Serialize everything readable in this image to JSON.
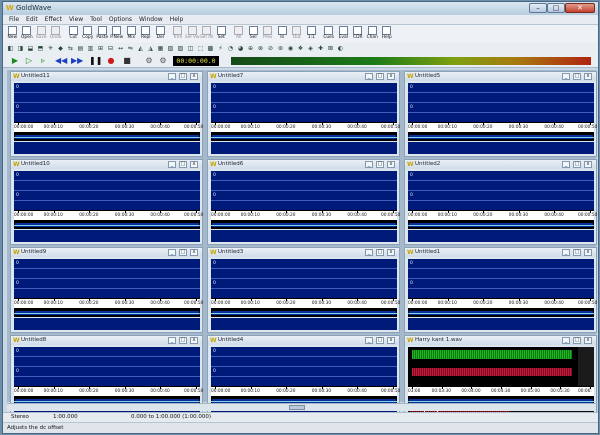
{
  "window": {
    "title": "GoldWave"
  },
  "menu": [
    "File",
    "Edit",
    "Effect",
    "View",
    "Tool",
    "Options",
    "Window",
    "Help"
  ],
  "toolbar": [
    {
      "label": "New",
      "enabled": true
    },
    {
      "label": "Open",
      "enabled": true
    },
    {
      "label": "Save",
      "enabled": false
    },
    {
      "label": "Undo",
      "enabled": false
    },
    {
      "label": "Cut",
      "enabled": true
    },
    {
      "label": "Copy",
      "enabled": true
    },
    {
      "label": "Paste",
      "enabled": true
    },
    {
      "label": "P.New",
      "enabled": true
    },
    {
      "label": "Mix",
      "enabled": true
    },
    {
      "label": "Repl",
      "enabled": true
    },
    {
      "label": "Del",
      "enabled": true
    },
    {
      "label": "Trim",
      "enabled": false
    },
    {
      "label": "Sel Vw",
      "enabled": false
    },
    {
      "label": "Sel All",
      "enabled": false
    },
    {
      "label": "Set",
      "enabled": true
    },
    {
      "label": "All",
      "enabled": false
    },
    {
      "label": "Sel",
      "enabled": true
    },
    {
      "label": "Prev",
      "enabled": false
    },
    {
      "label": "In",
      "enabled": true
    },
    {
      "label": "Out",
      "enabled": false
    },
    {
      "label": "1:1",
      "enabled": true
    },
    {
      "label": "Cues",
      "enabled": true
    },
    {
      "label": "Eval",
      "enabled": true
    },
    {
      "label": "CDR",
      "enabled": true
    },
    {
      "label": "Chan",
      "enabled": true
    },
    {
      "label": "Help",
      "enabled": true
    }
  ],
  "transport": {
    "counter": "00:00:00.0"
  },
  "documents": [
    {
      "name": "Untitled11",
      "ticks": [
        "00:00:00",
        "00:00:10",
        "00:00:20",
        "00:00:30",
        "00:00:40",
        "00:00:50"
      ],
      "amp": "0",
      "kind": "empty"
    },
    {
      "name": "Untitled7",
      "ticks": [
        "00:00:00",
        "00:00:10",
        "00:00:20",
        "00:00:30",
        "00:00:40",
        "00:00:50"
      ],
      "amp": "0",
      "kind": "empty"
    },
    {
      "name": "Untitled5",
      "ticks": [
        "00:00:00",
        "00:00:10",
        "00:00:20",
        "00:00:30",
        "00:00:40",
        "00:00:50"
      ],
      "amp": "0",
      "kind": "empty"
    },
    {
      "name": "Untitled10",
      "ticks": [
        "00:00:00",
        "00:00:10",
        "00:00:20",
        "00:00:30",
        "00:00:40",
        "00:00:50"
      ],
      "amp": "0",
      "kind": "empty"
    },
    {
      "name": "Untitled6",
      "ticks": [
        "00:00:00",
        "00:00:10",
        "00:00:20",
        "00:00:30",
        "00:00:40",
        "00:00:50"
      ],
      "amp": "0",
      "kind": "empty"
    },
    {
      "name": "Untitled2",
      "ticks": [
        "00:00:00",
        "00:00:10",
        "00:00:20",
        "00:00:30",
        "00:00:40",
        "00:00:50"
      ],
      "amp": "0",
      "kind": "empty"
    },
    {
      "name": "Untitled9",
      "ticks": [
        "00:00:00",
        "00:00:10",
        "00:00:20",
        "00:00:30",
        "00:00:40",
        "00:00:50"
      ],
      "amp": "0",
      "kind": "empty"
    },
    {
      "name": "Untitled3",
      "ticks": [
        "00:00:00",
        "00:00:10",
        "00:00:20",
        "00:00:30",
        "00:00:40",
        "00:00:50"
      ],
      "amp": "0",
      "kind": "empty"
    },
    {
      "name": "Untitled1",
      "ticks": [
        "00:00:00",
        "00:00:10",
        "00:00:20",
        "00:00:30",
        "00:00:40",
        "00:00:50"
      ],
      "amp": "0",
      "kind": "empty"
    },
    {
      "name": "Untitled8",
      "ticks": [
        "00:00:00",
        "00:00:10",
        "00:00:20",
        "00:00:30",
        "00:00:40",
        "00:00:50"
      ],
      "amp": "0",
      "kind": "empty"
    },
    {
      "name": "Untitled4",
      "ticks": [
        "00:00:00",
        "00:00:10",
        "00:00:20",
        "00:00:30",
        "00:00:40",
        "00:00:50"
      ],
      "amp": "0",
      "kind": "empty"
    },
    {
      "name": "Harry kant 1.wav",
      "ticks": [
        "03:00",
        "00:03:30",
        "00:04:00",
        "00:04:30",
        "00:05:00",
        "00:05:30",
        "00:06:"
      ],
      "amp": "",
      "kind": "audio"
    }
  ],
  "status": {
    "channels": "Stereo",
    "length": "1:00.000",
    "selection": "0.000 to 1:00.000 (1:00.000)"
  },
  "hint": "Adjusts the dc offset",
  "colors": {
    "wave_bg": "#001a7a",
    "gridline": "#3f5bbd",
    "overview": "#0b2f9a",
    "left_channel": "#1fb421",
    "right_channel": "#c8173a"
  }
}
